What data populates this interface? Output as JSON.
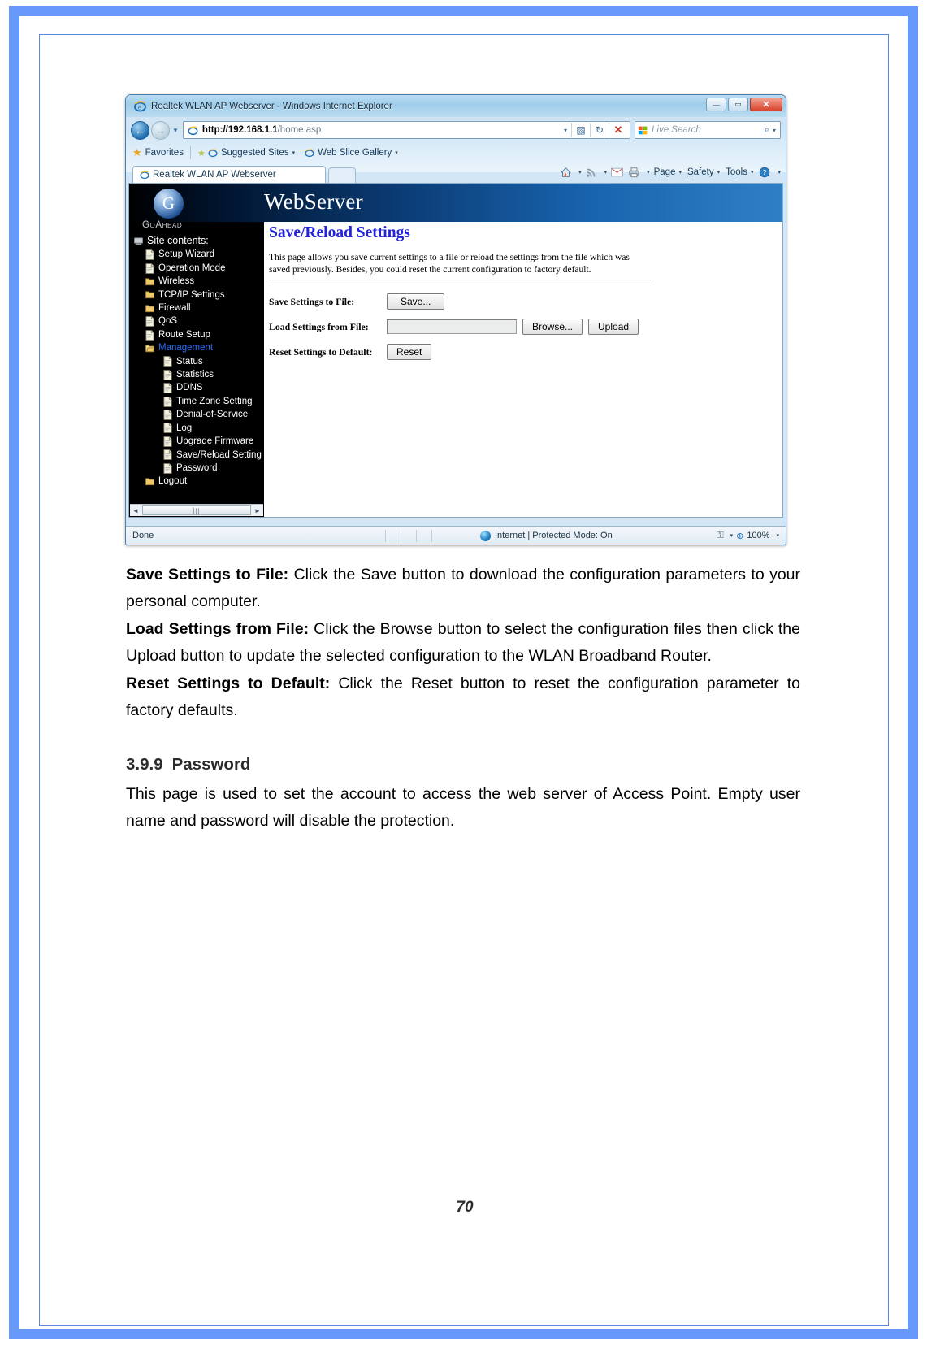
{
  "browser": {
    "title": "Realtek WLAN AP Webserver - Windows Internet Explorer",
    "window_buttons": {
      "minimize": "—",
      "maximize": "▭",
      "close": "✕"
    },
    "address": {
      "protocol_host": "http://192.168.1.1",
      "path": "/home.asp",
      "dropdown_caret": "▾"
    },
    "address_icons": {
      "compat": "▨",
      "refresh": "↻",
      "stop": "✕"
    },
    "search": {
      "placeholder": "Live Search",
      "caret": "▾",
      "magnifier": "⌕"
    },
    "favorites_bar": {
      "favorites_label": "Favorites",
      "suggested_sites": "Suggested Sites",
      "web_slice_gallery": "Web Slice Gallery",
      "caret": "▾"
    },
    "tab_label": "Realtek WLAN AP Webserver",
    "command_bar": {
      "home_icon": "⌂",
      "feeds_icon": "⌘",
      "mail_icon": "✉",
      "print_icon": "⎙",
      "page": "Page",
      "safety": "Safety",
      "tools": "Tools",
      "help": "?",
      "caret": "▾"
    },
    "status_bar": {
      "state": "Done",
      "zone": "Internet | Protected Mode: On",
      "zoom": "100%",
      "lock_icon": "🔒",
      "caret": "▾"
    },
    "hscrollbar": {
      "left_arrow": "◄",
      "right_arrow": "►",
      "grip": "|||"
    }
  },
  "webserver": {
    "banner_title": "WebServer",
    "brand": "GoAhead",
    "logo_glyph": "G",
    "tree_root": "Site contents:",
    "tree": [
      {
        "label": "Setup Wizard",
        "level": 1,
        "icon": "page-icon",
        "active": false
      },
      {
        "label": "Operation Mode",
        "level": 1,
        "icon": "page-icon",
        "active": false
      },
      {
        "label": "Wireless",
        "level": 1,
        "icon": "folder-icon",
        "active": false
      },
      {
        "label": "TCP/IP Settings",
        "level": 1,
        "icon": "folder-icon",
        "active": false
      },
      {
        "label": "Firewall",
        "level": 1,
        "icon": "folder-icon",
        "active": false
      },
      {
        "label": "QoS",
        "level": 1,
        "icon": "page-icon",
        "active": false
      },
      {
        "label": "Route Setup",
        "level": 1,
        "icon": "page-icon",
        "active": false
      },
      {
        "label": "Management",
        "level": 1,
        "icon": "folder-open-icon",
        "active": true
      },
      {
        "label": "Status",
        "level": 2,
        "icon": "page-icon",
        "active": false
      },
      {
        "label": "Statistics",
        "level": 2,
        "icon": "page-icon",
        "active": false
      },
      {
        "label": "DDNS",
        "level": 2,
        "icon": "page-icon",
        "active": false
      },
      {
        "label": "Time Zone Setting",
        "level": 2,
        "icon": "page-icon",
        "active": false
      },
      {
        "label": "Denial-of-Service",
        "level": 2,
        "icon": "page-icon",
        "active": false
      },
      {
        "label": "Log",
        "level": 2,
        "icon": "page-icon",
        "active": false
      },
      {
        "label": "Upgrade Firmware",
        "level": 2,
        "icon": "page-icon",
        "active": false
      },
      {
        "label": "Save/Reload Setting",
        "level": 2,
        "icon": "page-icon",
        "active": false
      },
      {
        "label": "Password",
        "level": 2,
        "icon": "page-icon",
        "active": false
      },
      {
        "label": "Logout",
        "level": 1,
        "icon": "folder-icon",
        "active": false
      }
    ],
    "panel": {
      "heading": "Save/Reload Settings",
      "description": "This page allows you save current settings to a file or reload the settings from the file which was saved previously. Besides, you could reset the current configuration to factory default.",
      "rows": [
        {
          "label": "Save Settings to File:",
          "button": "Save..."
        },
        {
          "label": "Load Settings from File:",
          "field_value": "",
          "button": "Browse...",
          "button2": "Upload"
        },
        {
          "label": "Reset Settings to Default:",
          "button": "Reset"
        }
      ]
    }
  },
  "document": {
    "paragraphs": [
      {
        "lead": "Save Settings to File:",
        "text": " Click the Save button to download the configuration parameters to your personal computer."
      },
      {
        "lead": "Load Settings from File:",
        "text": " Click the Browse button to select the configuration files then click the Upload button to update the selected configuration to the WLAN Broadband Router."
      },
      {
        "lead": "Reset Settings to Default:",
        "text": " Click the Reset button to reset the configuration parameter to factory defaults."
      }
    ],
    "section": {
      "number": "3.9.9",
      "title": "Password"
    },
    "section_body": "This page is used to set the account to access the web server of Access Point. Empty user name and password will disable the protection.",
    "page_number": "70"
  },
  "colors": {
    "page_border": "#6699fa",
    "heading_blue": "#2323dd",
    "tree_active": "#2b6df0"
  }
}
